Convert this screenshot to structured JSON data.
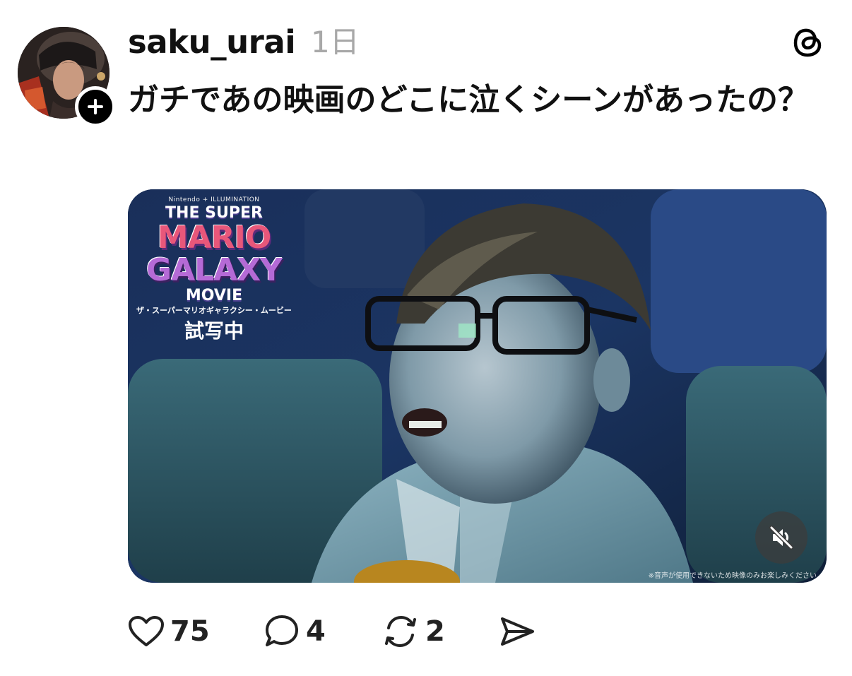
{
  "post": {
    "username": "saku_urai",
    "timestamp": "1日",
    "text": "ガチであの映画のどこに泣くシーンがあったの？"
  },
  "video": {
    "logo_brand": "Nintendo + ILLUMINATION",
    "logo_the": "THE SUPER",
    "logo_mario": "MARIO",
    "logo_galaxy": "GALAXY",
    "logo_movie": "MOVIE",
    "logo_kana": "ザ・スーパーマリオギャラクシー・ムービー",
    "logo_screening": "試写中",
    "disclaimer": "※音声が使用できないため映像のみお楽しみください"
  },
  "actions": {
    "likes": "75",
    "replies": "4",
    "reposts": "2"
  },
  "icons": {
    "follow": "plus-icon",
    "app": "threads-logo-icon",
    "mute": "speaker-muted-icon",
    "like": "heart-icon",
    "reply": "comment-icon",
    "repost": "repost-icon",
    "share": "send-icon"
  }
}
